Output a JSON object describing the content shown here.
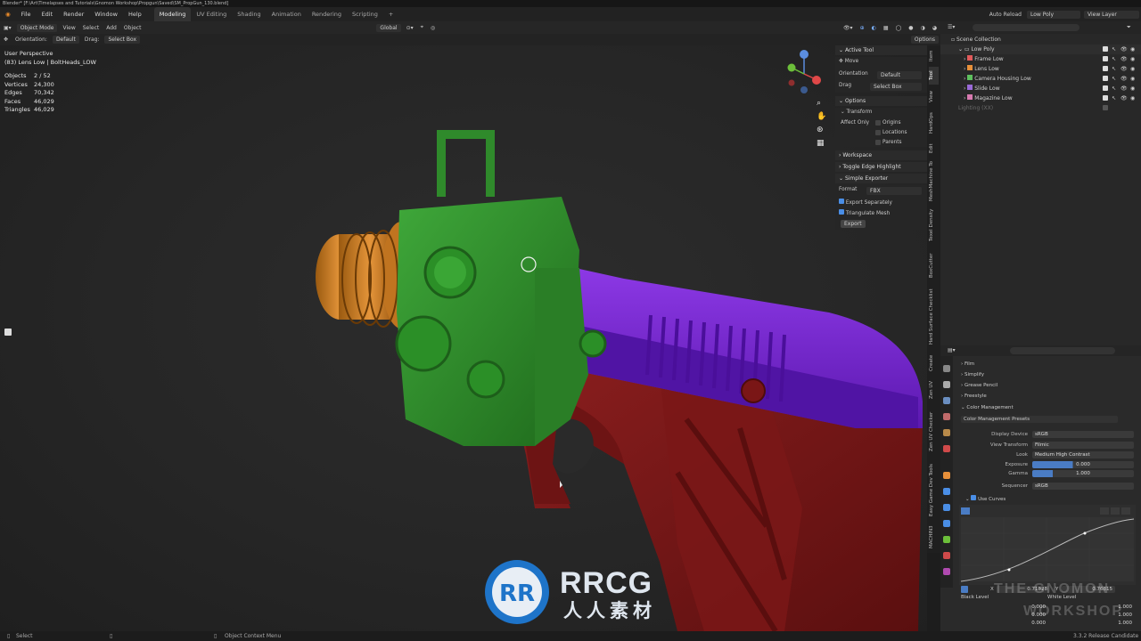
{
  "title_bar": "Blender* [F:\\Art\\Timelapses and Tutorials\\Gnomon Workshop\\Propgun\\Saved\\SM_PropGun_130.blend]",
  "menu": [
    "File",
    "Edit",
    "Render",
    "Window",
    "Help"
  ],
  "workspaces": [
    "Modeling",
    "UV Editing",
    "Shading",
    "Animation",
    "Rendering",
    "Scripting"
  ],
  "top_right": {
    "auto_reload": "Auto Reload",
    "scene": "Low Poly",
    "view_layer": "View Layer"
  },
  "header": {
    "mode": "Object Mode",
    "view": "View",
    "select": "Select",
    "add": "Add",
    "object": "Object",
    "orientation_global": "Global"
  },
  "tool_header": {
    "orientation_label": "Orientation:",
    "orientation_value": "Default",
    "drag_label": "Drag:",
    "drag_value": "Select Box",
    "options": "Options"
  },
  "overlay": {
    "perspective": "User Perspective",
    "active": "(83) Lens Low | BoltHeads_LOW",
    "stats": [
      {
        "k": "Objects",
        "v": "2 / 52"
      },
      {
        "k": "Vertices",
        "v": "24,300"
      },
      {
        "k": "Edges",
        "v": "70,342"
      },
      {
        "k": "Faces",
        "v": "46,029"
      },
      {
        "k": "Triangles",
        "v": "46,029"
      }
    ]
  },
  "npanel": {
    "active_tool": "Active Tool",
    "move": "Move",
    "orientation_label": "Orientation",
    "orientation_value": "Default",
    "drag_label": "Drag",
    "drag_value": "Select Box",
    "options": "Options",
    "transform": "Transform",
    "affect_only": "Affect Only",
    "origins": "Origins",
    "locations": "Locations",
    "parents": "Parents",
    "workspace": "Workspace",
    "toggle_edge": "Toggle Edge Highlight",
    "simple_exporter": "Simple Exporter",
    "format_label": "Format",
    "format_value": "FBX",
    "export_separately": "Export Separately",
    "triangulate": "Triangulate Mesh",
    "export_btn": "Export"
  },
  "side_tabs": [
    "Item",
    "Tool",
    "View",
    "HardOps",
    "Edit",
    "MeshMachine Tools",
    "Texel Density",
    "BoxCutter",
    "Hard Surface Checklist",
    "Create",
    "Zen UV",
    "Zen UV Checker",
    "Easy Game Dev Tools",
    "MACHIN3"
  ],
  "outliner": {
    "root": "Scene Collection",
    "collection": "Low Poly",
    "items": [
      {
        "name": "Frame Low",
        "color": "#e05a5a"
      },
      {
        "name": "Lens Low",
        "color": "#e8903a"
      },
      {
        "name": "Camera Housing Low",
        "color": "#5ec05e"
      },
      {
        "name": "Slide Low",
        "color": "#9a6ad8"
      },
      {
        "name": "Magazine Low",
        "color": "#d87ab0"
      }
    ],
    "disabled": "Lighting (XX)"
  },
  "properties": {
    "sections": [
      "Film",
      "Simplify",
      "Grease Pencil",
      "Freestyle",
      "Color Management"
    ],
    "preset": "Color Management Presets",
    "fields": [
      {
        "k": "Display Device",
        "v": "sRGB"
      },
      {
        "k": "View Transform",
        "v": "Filmic"
      },
      {
        "k": "Look",
        "v": "Medium High Contrast"
      },
      {
        "k": "Exposure",
        "v": "0.000"
      },
      {
        "k": "Gamma",
        "v": "1.000"
      },
      {
        "k": "Sequencer",
        "v": "sRGB"
      }
    ],
    "use_curves": "Use Curves",
    "black_level": "Black Level",
    "white_level": "White Level",
    "curve_x": "0.71828",
    "curve_y": "0.76815",
    "bl_vals": [
      "0.000",
      "0.000",
      "0.000"
    ],
    "wl_vals": [
      "1.000",
      "1.000",
      "1.000"
    ]
  },
  "status": {
    "left": "Select",
    "mid": "Object Context Menu",
    "version": "3.3.2 Release Candidate"
  },
  "watermark": {
    "brand": "RRCG",
    "sub": "人人素材",
    "gnomon_top": "THE GNOMON",
    "gnomon_bottom": "WORKSHOP"
  }
}
